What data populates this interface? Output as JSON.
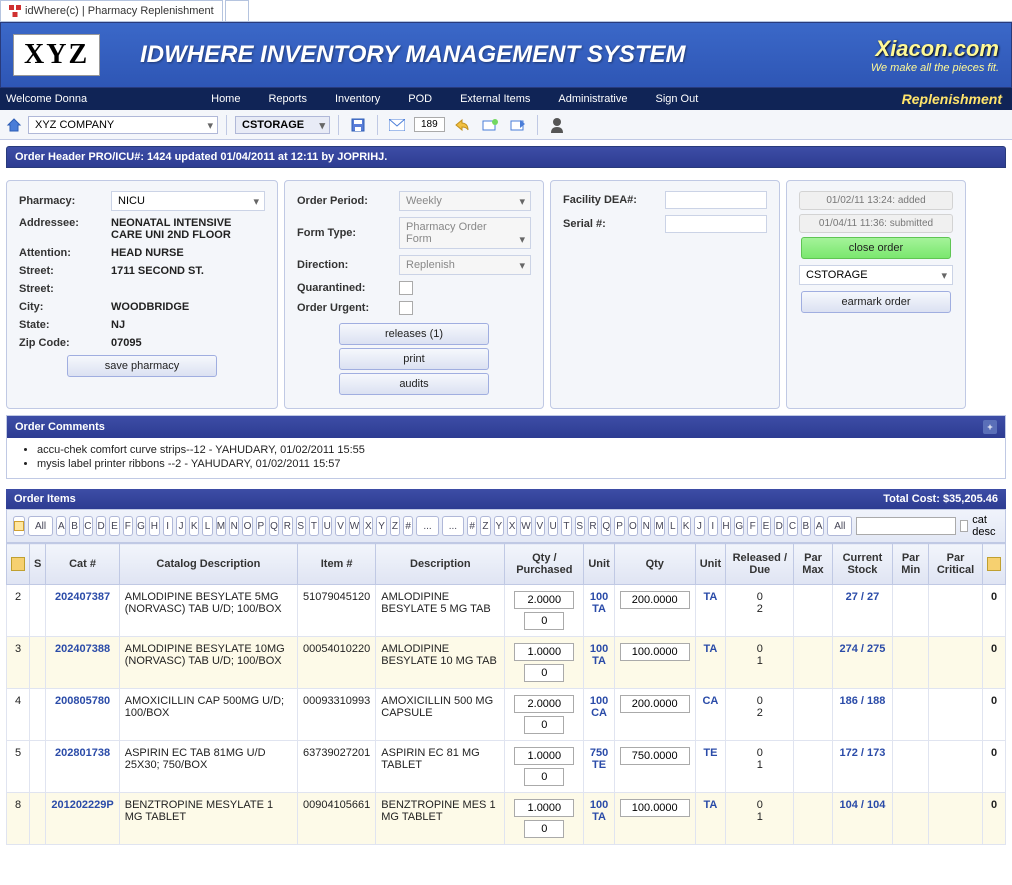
{
  "tab": {
    "title": "idWhere(c) | Pharmacy Replenishment"
  },
  "header": {
    "logo": "XYZ",
    "title": "IDWHERE INVENTORY MANAGEMENT SYSTEM",
    "brand": "Xiacon.com",
    "tagline": "We make all the pieces fit."
  },
  "nav": {
    "welcome": "Welcome Donna",
    "items": [
      "Home",
      "Reports",
      "Inventory",
      "POD",
      "External Items",
      "Administrative",
      "Sign Out"
    ],
    "badge": "Replenishment"
  },
  "toolbar": {
    "company": "XYZ COMPANY",
    "storage": "CSTORAGE",
    "msgcount": "189"
  },
  "order": {
    "header": "Order Header PRO/ICU#: 1424  updated 01/04/2011 at 12:11 by JOPRIHJ."
  },
  "pharmacy": {
    "label_pharmacy": "Pharmacy:",
    "value": "NICU",
    "label_addressee": "Addressee:",
    "addressee": "NEONATAL INTENSIVE CARE UNI 2ND FLOOR",
    "label_attention": "Attention:",
    "attention": "HEAD NURSE",
    "label_street": "Street:",
    "street": "1711 SECOND ST.",
    "label_street2": "Street:",
    "street2": "",
    "label_city": "City:",
    "city": "WOODBRIDGE",
    "label_state": "State:",
    "state": "NJ",
    "label_zip": "Zip Code:",
    "zip": "07095",
    "btn_save": "save pharmacy"
  },
  "orderform": {
    "label_period": "Order Period:",
    "period": "Weekly",
    "label_formtype": "Form Type:",
    "formtype": "Pharmacy Order Form",
    "label_direction": "Direction:",
    "direction": "Replenish",
    "label_quarantined": "Quarantined:",
    "label_urgent": "Order Urgent:",
    "btn_releases": "releases (1)",
    "btn_print": "print",
    "btn_audits": "audits"
  },
  "facility": {
    "label_dea": "Facility DEA#:",
    "dea": "",
    "label_serial": "Serial #:",
    "serial": ""
  },
  "actions": {
    "audit1": "01/02/11 13:24: added",
    "audit2": "01/04/11 11:36: submitted",
    "btn_close": "close order",
    "storage": "CSTORAGE",
    "btn_earmark": "earmark order"
  },
  "comments": {
    "title": "Order Comments",
    "items": [
      "accu-chek comfort curve strips--12 - YAHUDARY, 01/02/2011 15:55",
      "mysis label printer ribbons --2 - YAHUDARY, 01/02/2011 15:57"
    ]
  },
  "items": {
    "title": "Order Items",
    "total_label": "Total Cost: $35,205.46",
    "catdesc_label": "cat desc",
    "filters": [
      "All",
      "A",
      "B",
      "C",
      "D",
      "E",
      "F",
      "G",
      "H",
      "I",
      "J",
      "K",
      "L",
      "M",
      "N",
      "O",
      "P",
      "Q",
      "R",
      "S",
      "T",
      "U",
      "V",
      "W",
      "X",
      "Y",
      "Z",
      "#",
      "..."
    ],
    "columns": [
      "",
      "S",
      "Cat #",
      "Catalog Description",
      "Item #",
      "Description",
      "Qty / Purchased",
      "Unit",
      "Qty",
      "Unit",
      "Released / Due",
      "Par Max",
      "Current Stock",
      "Par Min",
      "Par Critical",
      ""
    ],
    "rows": [
      {
        "n": "2",
        "cat": "202407387",
        "catdesc": "AMLODIPINE BESYLATE 5MG (NORVASC) TAB U/D; 100/BOX",
        "item": "51079045120",
        "desc": "AMLODIPINE BESYLATE 5 MG TAB",
        "q1": "2.0000",
        "q1b": "0",
        "unit1": "100 TA",
        "q2": "200.0000",
        "unit2": "TA",
        "rel": "0",
        "due": "2",
        "stock": "27 / 27",
        "crit": "0",
        "alt": false
      },
      {
        "n": "3",
        "cat": "202407388",
        "catdesc": "AMLODIPINE BESYLATE 10MG (NORVASC) TAB U/D; 100/BOX",
        "item": "00054010220",
        "desc": "AMLODIPINE BESYLATE 10 MG TAB",
        "q1": "1.0000",
        "q1b": "0",
        "unit1": "100 TA",
        "q2": "100.0000",
        "unit2": "TA",
        "rel": "0",
        "due": "1",
        "stock": "274 / 275",
        "crit": "0",
        "alt": true
      },
      {
        "n": "4",
        "cat": "200805780",
        "catdesc": "AMOXICILLIN CAP 500MG U/D; 100/BOX",
        "item": "00093310993",
        "desc": "AMOXICILLIN 500 MG CAPSULE",
        "q1": "2.0000",
        "q1b": "0",
        "unit1": "100 CA",
        "q2": "200.0000",
        "unit2": "CA",
        "rel": "0",
        "due": "2",
        "stock": "186 / 188",
        "crit": "0",
        "alt": false
      },
      {
        "n": "5",
        "cat": "202801738",
        "catdesc": "ASPIRIN EC TAB 81MG U/D 25X30; 750/BOX",
        "item": "63739027201",
        "desc": "ASPIRIN EC 81 MG TABLET",
        "q1": "1.0000",
        "q1b": "0",
        "unit1": "750 TE",
        "q2": "750.0000",
        "unit2": "TE",
        "rel": "0",
        "due": "1",
        "stock": "172 / 173",
        "crit": "0",
        "alt": false
      },
      {
        "n": "8",
        "cat": "201202229P",
        "catdesc": "BENZTROPINE MESYLATE 1 MG TABLET",
        "item": "00904105661",
        "desc": "BENZTROPINE MES 1 MG TABLET",
        "q1": "1.0000",
        "q1b": "0",
        "unit1": "100 TA",
        "q2": "100.0000",
        "unit2": "TA",
        "rel": "0",
        "due": "1",
        "stock": "104 / 104",
        "crit": "0",
        "alt": true
      }
    ]
  }
}
